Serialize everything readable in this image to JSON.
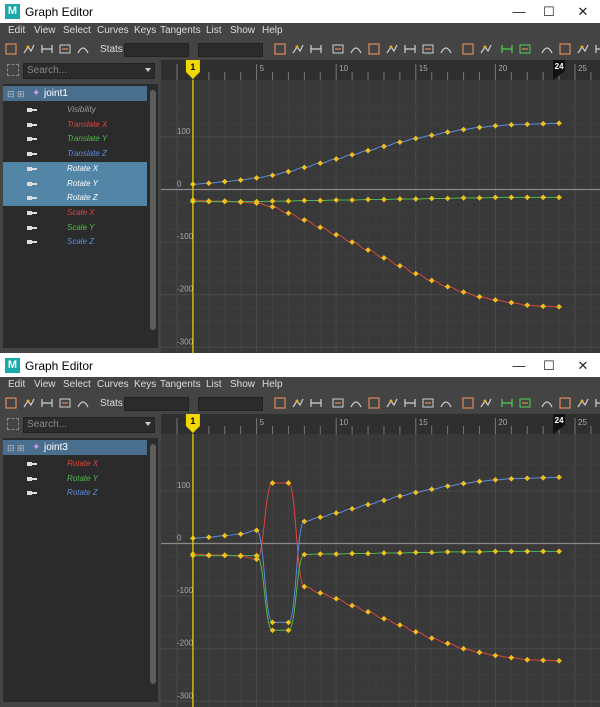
{
  "colors": {
    "x_curve": "#e0453a",
    "y_curve": "#4fb84a",
    "z_curve": "#5b8ce0",
    "key": "#f0c020",
    "time_marker": "#f0d800",
    "graph_bg": "#393939"
  },
  "menu": [
    "Edit",
    "View",
    "Select",
    "Curves",
    "Keys",
    "Tangents",
    "List",
    "Show",
    "Help"
  ],
  "toolbar": {
    "stats_label": "Stats"
  },
  "search": {
    "placeholder": "Search..."
  },
  "time_marker": {
    "label": "1",
    "frame": 1
  },
  "end_frame_label": "24",
  "x_ticks": [
    "5",
    "10",
    "15",
    "20",
    "25"
  ],
  "y_ticks": [
    "100",
    "0",
    "-100",
    "-200",
    "-300"
  ],
  "windows": [
    {
      "title": "Graph Editor",
      "joint": "joint1",
      "attributes": [
        {
          "name": "Visibility",
          "color": "#9a9a9a",
          "selected": false
        },
        {
          "name": "Translate X",
          "color": "#e0453a",
          "selected": false
        },
        {
          "name": "Translate Y",
          "color": "#4fb84a",
          "selected": false
        },
        {
          "name": "Translate Z",
          "color": "#5b8ce0",
          "selected": false
        },
        {
          "name": "Rotate X",
          "color": "#ffffff",
          "selected": true
        },
        {
          "name": "Rotate Y",
          "color": "#ffffff",
          "selected": true
        },
        {
          "name": "Rotate Z",
          "color": "#ffffff",
          "selected": true
        },
        {
          "name": "Scale X",
          "color": "#e0453a",
          "selected": false
        },
        {
          "name": "Scale Y",
          "color": "#4fb84a",
          "selected": false
        },
        {
          "name": "Scale Z",
          "color": "#5b8ce0",
          "selected": false
        }
      ]
    },
    {
      "title": "Graph Editor",
      "joint": "joint3",
      "attributes": [
        {
          "name": "Rotate X",
          "color": "#e0453a",
          "selected": false
        },
        {
          "name": "Rotate Y",
          "color": "#4fb84a",
          "selected": false
        },
        {
          "name": "Rotate Z",
          "color": "#5b8ce0",
          "selected": false
        }
      ]
    }
  ],
  "chart_data": [
    {
      "type": "line",
      "xlim": [
        0,
        26
      ],
      "ylim": [
        -305,
        180
      ],
      "series": [
        {
          "name": "Rotate X",
          "x": [
            1,
            2,
            3,
            4,
            5,
            6,
            7,
            8,
            9,
            10,
            11,
            12,
            13,
            14,
            15,
            16,
            17,
            18,
            19,
            20,
            21,
            22,
            23,
            24
          ],
          "y": [
            -20,
            -22,
            -22,
            -24,
            -26,
            -33,
            -45,
            -58,
            -72,
            -86,
            -100,
            -115,
            -130,
            -145,
            -160,
            -173,
            -185,
            -195,
            -204,
            -210,
            -215,
            -220,
            -222,
            -223
          ]
        },
        {
          "name": "Rotate Y",
          "x": [
            1,
            2,
            3,
            4,
            5,
            6,
            7,
            8,
            9,
            10,
            11,
            12,
            13,
            14,
            15,
            16,
            17,
            18,
            19,
            20,
            21,
            22,
            23,
            24
          ],
          "y": [
            -23,
            -23,
            -23,
            -23,
            -23,
            -22,
            -22,
            -21,
            -21,
            -20,
            -20,
            -19,
            -19,
            -18,
            -18,
            -17,
            -17,
            -16,
            -16,
            -15,
            -15,
            -15,
            -15,
            -15
          ]
        },
        {
          "name": "Rotate Z",
          "x": [
            1,
            2,
            3,
            4,
            5,
            6,
            7,
            8,
            9,
            10,
            11,
            12,
            13,
            14,
            15,
            16,
            17,
            18,
            19,
            20,
            21,
            22,
            23,
            24
          ],
          "y": [
            10,
            12,
            15,
            18,
            22,
            27,
            34,
            42,
            50,
            58,
            66,
            74,
            82,
            90,
            97,
            103,
            109,
            114,
            118,
            121,
            123,
            124,
            125,
            126
          ]
        }
      ]
    },
    {
      "type": "line",
      "xlim": [
        0,
        26
      ],
      "ylim": [
        -305,
        180
      ],
      "series": [
        {
          "name": "Rotate X",
          "x": [
            1,
            2,
            3,
            4,
            5,
            6,
            7,
            8,
            9,
            10,
            11,
            12,
            13,
            14,
            15,
            16,
            17,
            18,
            19,
            20,
            21,
            22,
            23,
            24
          ],
          "y": [
            -20,
            -22,
            -22,
            -24,
            -30,
            115,
            115,
            -82,
            -94,
            -105,
            -118,
            -130,
            -143,
            -155,
            -168,
            -180,
            -190,
            -200,
            -207,
            -213,
            -217,
            -221,
            -222,
            -223
          ]
        },
        {
          "name": "Rotate Y",
          "x": [
            1,
            2,
            3,
            4,
            5,
            6,
            7,
            8,
            9,
            10,
            11,
            12,
            13,
            14,
            15,
            16,
            17,
            18,
            19,
            20,
            21,
            22,
            23,
            24
          ],
          "y": [
            -23,
            -23,
            -23,
            -23,
            -23,
            -165,
            -165,
            -21,
            -20,
            -20,
            -19,
            -19,
            -18,
            -18,
            -17,
            -17,
            -16,
            -16,
            -16,
            -15,
            -15,
            -15,
            -15,
            -15
          ]
        },
        {
          "name": "Rotate Z",
          "x": [
            1,
            2,
            3,
            4,
            5,
            6,
            7,
            8,
            9,
            10,
            11,
            12,
            13,
            14,
            15,
            16,
            17,
            18,
            19,
            20,
            21,
            22,
            23,
            24
          ],
          "y": [
            10,
            12,
            15,
            18,
            25,
            -150,
            -150,
            42,
            50,
            58,
            66,
            74,
            82,
            90,
            97,
            103,
            109,
            114,
            118,
            121,
            123,
            124,
            125,
            126
          ]
        }
      ]
    }
  ]
}
